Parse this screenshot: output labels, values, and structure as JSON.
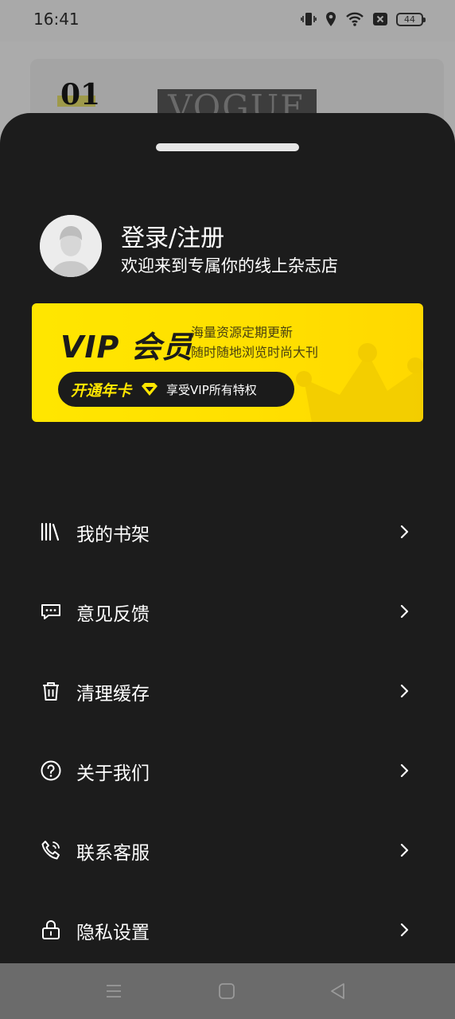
{
  "status": {
    "time": "16:41",
    "battery": "44"
  },
  "background": {
    "issue_number": "01",
    "cover_text": "VOGUE"
  },
  "profile": {
    "title": "登录/注册",
    "subtitle": "欢迎来到专属你的线上杂志店"
  },
  "vip": {
    "logo": "VIP 会员",
    "desc_line1": "海量资源定期更新",
    "desc_line2": "随时随地浏览时尚大刊",
    "cta_title": "开通年卡",
    "cta_text": "享受VIP所有特权",
    "accent": "#ffe600"
  },
  "menu": [
    {
      "label": "我的书架",
      "icon": "bookshelf-icon"
    },
    {
      "label": "意见反馈",
      "icon": "feedback-icon"
    },
    {
      "label": "清理缓存",
      "icon": "trash-icon"
    },
    {
      "label": "关于我们",
      "icon": "help-icon"
    },
    {
      "label": "联系客服",
      "icon": "phone-icon"
    },
    {
      "label": "隐私设置",
      "icon": "lock-icon"
    }
  ]
}
